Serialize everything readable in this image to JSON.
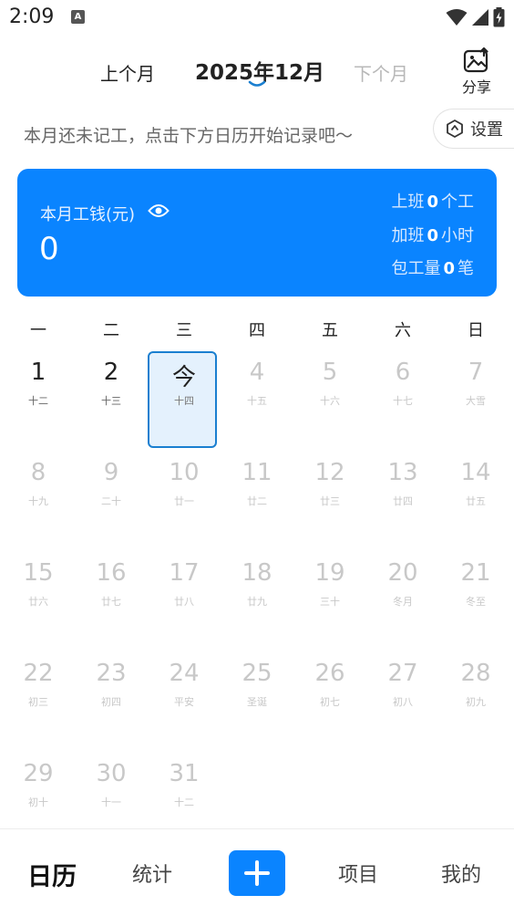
{
  "status_bar": {
    "time": "2:09",
    "app_badge": "A"
  },
  "header": {
    "prev_month": "上个月",
    "current_month": "2025年12月",
    "next_month": "下个月",
    "share_label": "分享"
  },
  "hint": {
    "text": "本月还未记工，点击下方日历开始记录吧～",
    "settings_label": "设置"
  },
  "wage_card": {
    "title": "本月工钱(元)",
    "amount": "0",
    "stats": [
      {
        "prefix": "上班",
        "value": "0",
        "suffix": "个工"
      },
      {
        "prefix": "加班",
        "value": "0",
        "suffix": "小时"
      },
      {
        "prefix": "包工量",
        "value": "0",
        "suffix": "笔"
      }
    ],
    "accent_color": "#0a84ff"
  },
  "weekdays": [
    "一",
    "二",
    "三",
    "四",
    "五",
    "六",
    "日"
  ],
  "calendar": {
    "rows": [
      [
        {
          "day": "1",
          "lunar": "十二",
          "state": "past"
        },
        {
          "day": "2",
          "lunar": "十三",
          "state": "past"
        },
        {
          "day": "今",
          "lunar": "十四",
          "state": "today"
        },
        {
          "day": "4",
          "lunar": "十五",
          "state": "future"
        },
        {
          "day": "5",
          "lunar": "十六",
          "state": "future"
        },
        {
          "day": "6",
          "lunar": "十七",
          "state": "future"
        },
        {
          "day": "7",
          "lunar": "大雪",
          "state": "future"
        }
      ],
      [
        {
          "day": "8",
          "lunar": "十九",
          "state": "future"
        },
        {
          "day": "9",
          "lunar": "二十",
          "state": "future"
        },
        {
          "day": "10",
          "lunar": "廿一",
          "state": "future"
        },
        {
          "day": "11",
          "lunar": "廿二",
          "state": "future"
        },
        {
          "day": "12",
          "lunar": "廿三",
          "state": "future"
        },
        {
          "day": "13",
          "lunar": "廿四",
          "state": "future"
        },
        {
          "day": "14",
          "lunar": "廿五",
          "state": "future"
        }
      ],
      [
        {
          "day": "15",
          "lunar": "廿六",
          "state": "future"
        },
        {
          "day": "16",
          "lunar": "廿七",
          "state": "future"
        },
        {
          "day": "17",
          "lunar": "廿八",
          "state": "future"
        },
        {
          "day": "18",
          "lunar": "廿九",
          "state": "future"
        },
        {
          "day": "19",
          "lunar": "三十",
          "state": "future"
        },
        {
          "day": "20",
          "lunar": "冬月",
          "state": "future"
        },
        {
          "day": "21",
          "lunar": "冬至",
          "state": "future"
        }
      ],
      [
        {
          "day": "22",
          "lunar": "初三",
          "state": "future"
        },
        {
          "day": "23",
          "lunar": "初四",
          "state": "future"
        },
        {
          "day": "24",
          "lunar": "平安",
          "state": "future"
        },
        {
          "day": "25",
          "lunar": "圣诞",
          "state": "future"
        },
        {
          "day": "26",
          "lunar": "初七",
          "state": "future"
        },
        {
          "day": "27",
          "lunar": "初八",
          "state": "future"
        },
        {
          "day": "28",
          "lunar": "初九",
          "state": "future"
        }
      ],
      [
        {
          "day": "29",
          "lunar": "初十",
          "state": "future"
        },
        {
          "day": "30",
          "lunar": "十一",
          "state": "future"
        },
        {
          "day": "31",
          "lunar": "十二",
          "state": "future"
        }
      ]
    ]
  },
  "bottom_nav": {
    "calendar": "日历",
    "stats": "统计",
    "projects": "项目",
    "mine": "我的"
  }
}
